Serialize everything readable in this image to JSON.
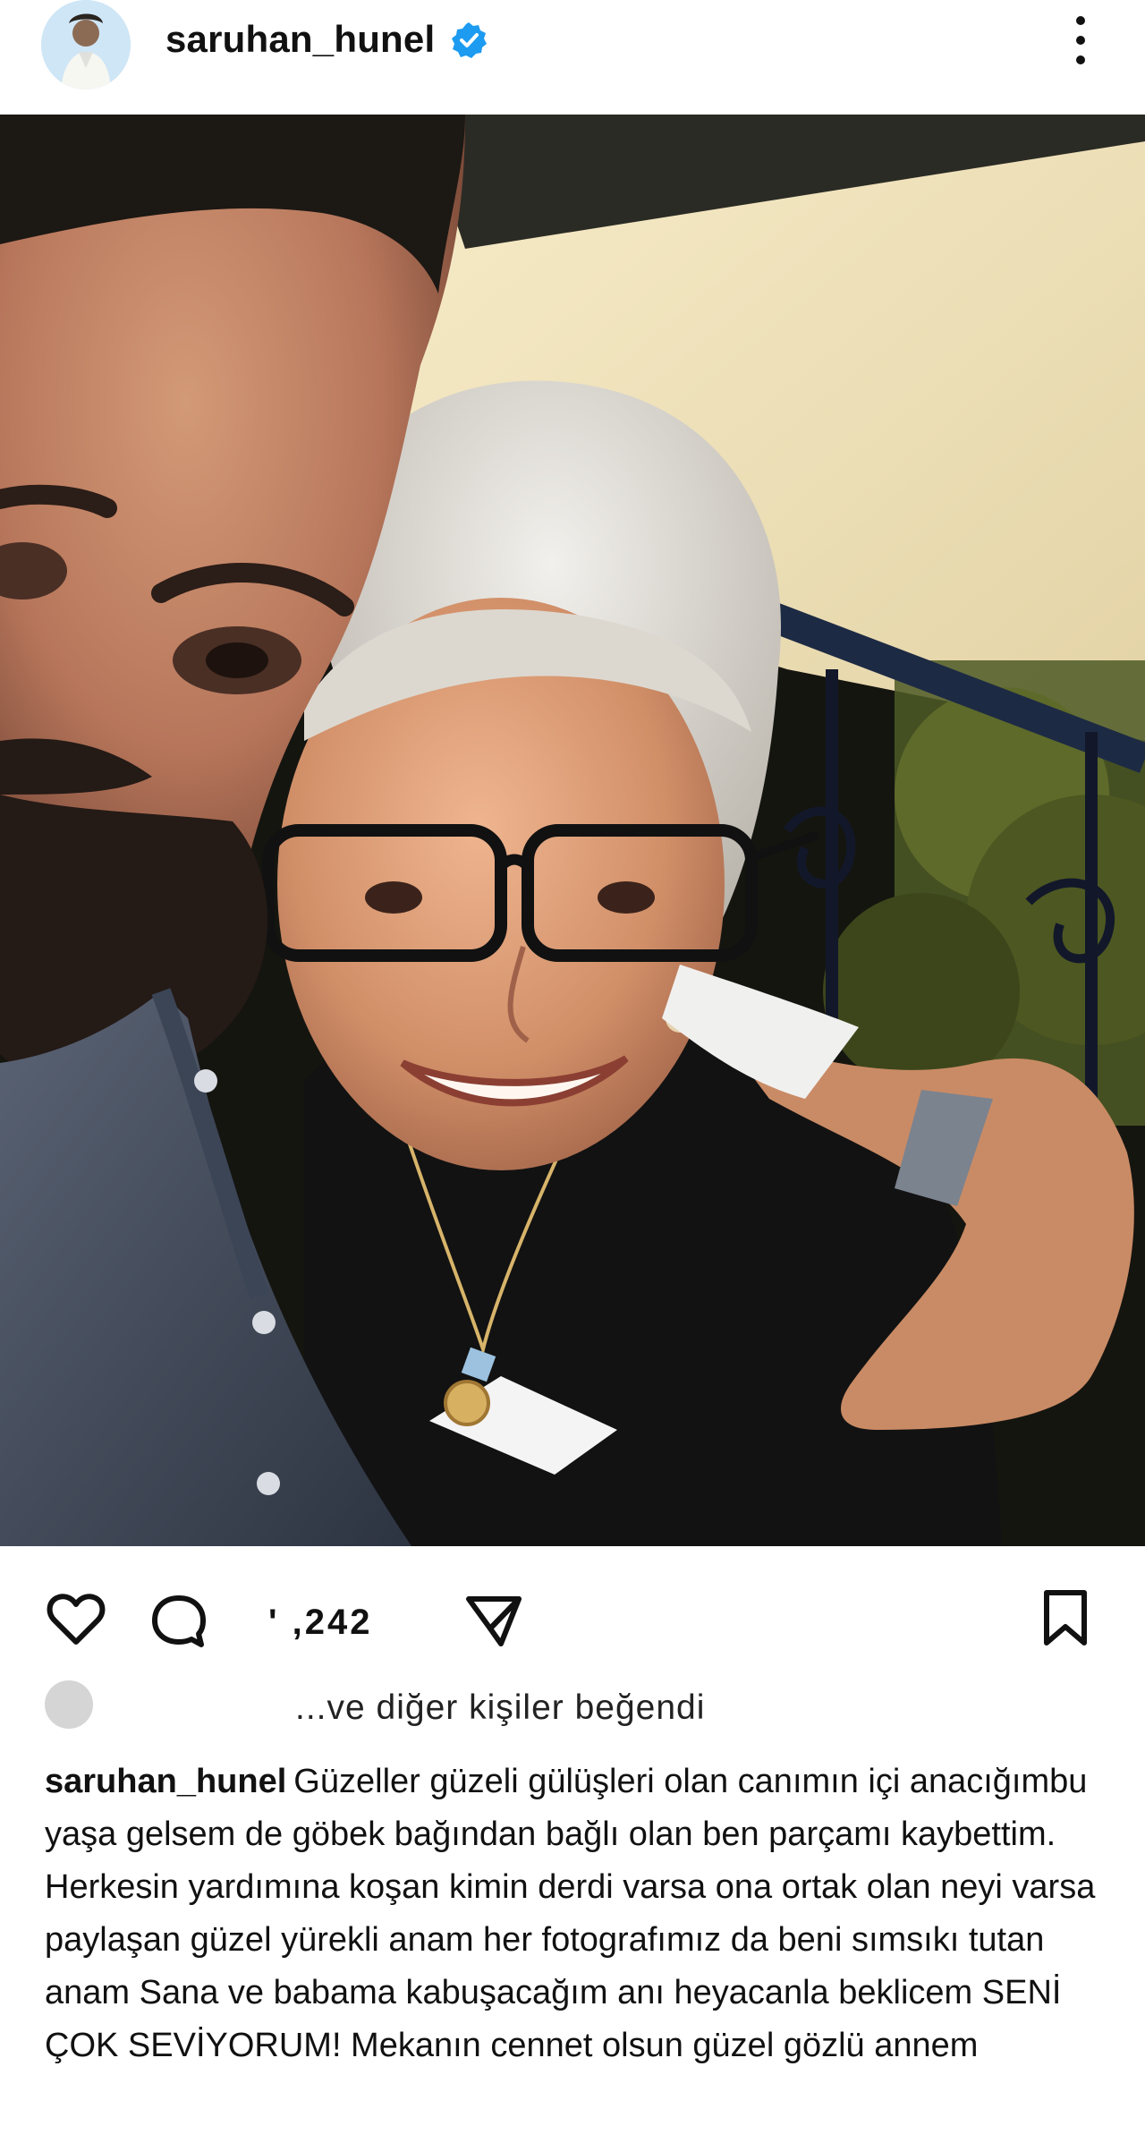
{
  "header": {
    "username": "saruhan_hunel",
    "verified_icon": "verified-badge-icon",
    "more_icon": "more-vertical-icon"
  },
  "post": {
    "photo_alt": "selfie of a man and an older woman"
  },
  "actions": {
    "like_icon": "heart-icon",
    "comment_icon": "comment-icon",
    "share_icon": "send-icon",
    "save_icon": "bookmark-icon",
    "count_text": "' ,242"
  },
  "likes": {
    "text": "...ve diğer kişiler beğendi"
  },
  "caption": {
    "username": "saruhan_hunel",
    "text": "Güzeller güzeli gülüşleri olan canımın içi anacığımbu yaşa gelsem de göbek bağından bağlı olan ben parçamı kaybettim.  Herkesin yardımına koşan kimin derdi varsa ona ortak olan neyi varsa paylaşan güzel yürekli anam her fotografımız da beni sımsıkı tutan anam Sana ve babama kabuşacağım anı heyacanla beklicem SENİ ÇOK SEVİYORUM! Mekanın cennet olsun güzel gözlü annem"
  }
}
